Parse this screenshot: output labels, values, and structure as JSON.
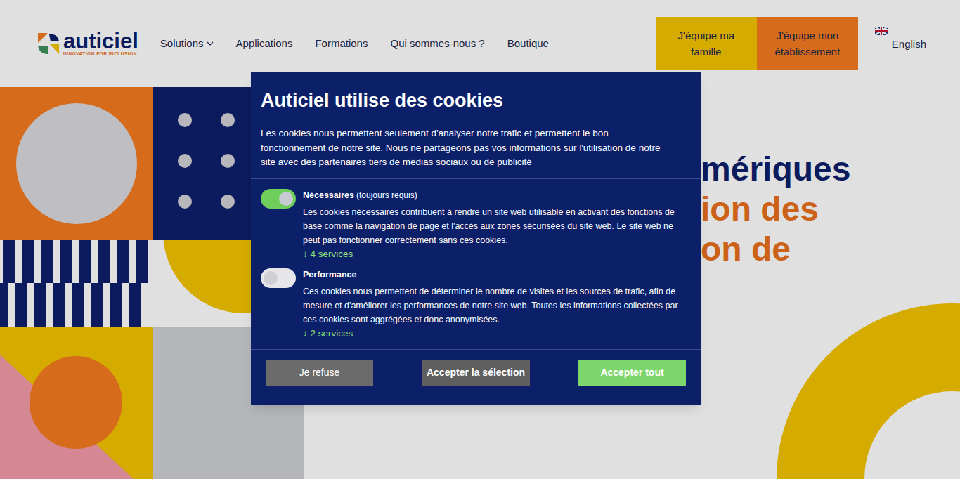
{
  "header": {
    "logo": {
      "name": "auticiel",
      "tagline": "INNOVATION FOR INCLUSION"
    },
    "nav": [
      {
        "label": "Solutions",
        "has_dropdown": true
      },
      {
        "label": "Applications",
        "has_dropdown": false
      },
      {
        "label": "Formations",
        "has_dropdown": false
      },
      {
        "label": "Qui sommes-nous ?",
        "has_dropdown": false
      },
      {
        "label": "Boutique",
        "has_dropdown": false
      }
    ],
    "cta": [
      {
        "label": "J'équipe ma famille",
        "color": "#f3c300"
      },
      {
        "label": "J'équipe mon établissement",
        "color": "#f37a1f"
      }
    ],
    "language": "English"
  },
  "hero": {
    "title_lines": [
      {
        "text": "mériques",
        "color": "#0d1f6b"
      },
      {
        "text": "ion des",
        "color": "#e8701c"
      },
      {
        "text": "on de",
        "color": "#e8701c"
      }
    ]
  },
  "cookie_dialog": {
    "title": "Auticiel utilise des cookies",
    "description": "Les cookies nous permettent seulement d'analyser notre trafic et permettent le bon fonctionnement de notre site. Nous ne partageons pas vos informations sur l'utilisation de notre site avec des partenaires tiers de médias sociaux ou de publicité",
    "categories": [
      {
        "name": "Nécessaires",
        "note": "(toujours requis)",
        "on": true,
        "description": "Les cookies nécessaires contribuent à rendre un site web utilisable en activant des fonctions de base comme la navigation de page et l'accès aux zones sécurisées du site web. Le site web ne peut pas fonctionner correctement sans ces cookies.",
        "services": "↓ 4 services"
      },
      {
        "name": "Performance",
        "note": "",
        "on": false,
        "description": "Ces cookies nous permettent de déterminer le nombre de visites et les sources de trafic, afin de mesure et d'améliorer les performances de notre site web. Toutes les informations collectées par ces cookies sont aggrégées et donc anonymisées.",
        "services": "↓ 2 services"
      }
    ],
    "buttons": [
      {
        "label": "Je refuse",
        "kind": "refuse"
      },
      {
        "label": "Accepter la sélection",
        "kind": "selection"
      },
      {
        "label": "Accepter tout",
        "kind": "accept"
      }
    ]
  }
}
